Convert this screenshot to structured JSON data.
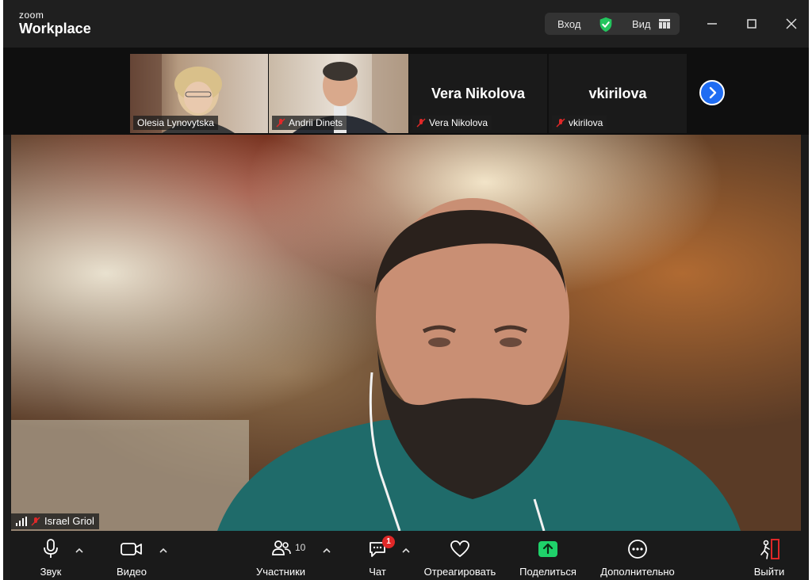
{
  "app": {
    "logo_top": "zoom",
    "logo_main": "Workplace"
  },
  "titlebar": {
    "login_label": "Вход",
    "view_label": "Вид"
  },
  "thumbnails": [
    {
      "name": "Olesia Lynovytska",
      "muted": false
    },
    {
      "name": "Andrii Dinets",
      "muted": true
    },
    {
      "name": "Vera Nikolova",
      "display_name": "Vera Nikolova",
      "muted": true
    },
    {
      "name": "vkirilova",
      "display_name": "vkirilova",
      "muted": true
    }
  ],
  "main": {
    "speaker_name": "Israel Griol"
  },
  "toolbar": {
    "audio": "Звук",
    "video": "Видео",
    "participants": "Участники",
    "participants_count": "10",
    "chat": "Чат",
    "chat_badge": "1",
    "react": "Отреагировать",
    "share": "Поделиться",
    "more": "Дополнительно",
    "leave": "Выйти"
  },
  "colors": {
    "accent": "#1f6cf2",
    "share": "#1fd16a",
    "muted": "#e02828",
    "leave": "#e02828"
  }
}
